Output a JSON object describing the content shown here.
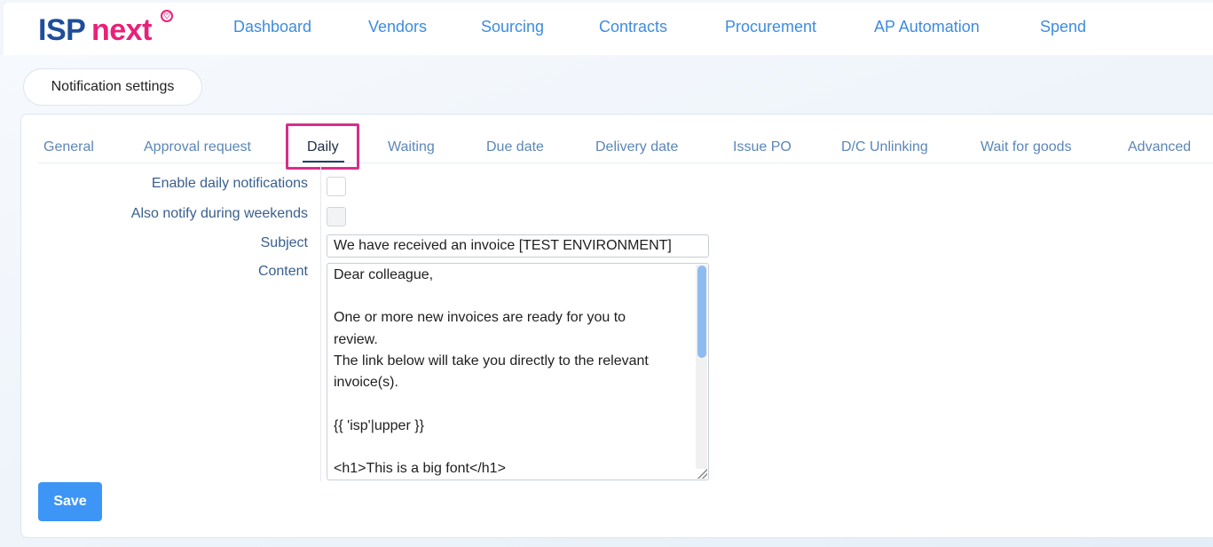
{
  "brand": {
    "logo_isp": "ISP",
    "logo_next": "next",
    "logo_mark": "♡",
    "accent": "#e8217a",
    "primary": "#1e4d9b"
  },
  "nav": {
    "items": [
      {
        "label": "Dashboard"
      },
      {
        "label": "Vendors"
      },
      {
        "label": "Sourcing"
      },
      {
        "label": "Contracts"
      },
      {
        "label": "Procurement"
      },
      {
        "label": "AP Automation"
      },
      {
        "label": "Spend"
      }
    ]
  },
  "page": {
    "title": "Notification settings"
  },
  "tabs": {
    "items": [
      {
        "label": "General"
      },
      {
        "label": "Approval request"
      },
      {
        "label": "Daily",
        "active": true
      },
      {
        "label": "Waiting"
      },
      {
        "label": "Due date"
      },
      {
        "label": "Delivery date"
      },
      {
        "label": "Issue PO"
      },
      {
        "label": "D/C Unlinking"
      },
      {
        "label": "Wait for goods"
      },
      {
        "label": "Advanced"
      }
    ]
  },
  "form": {
    "enable_daily_label": "Enable daily notifications",
    "enable_daily_checked": false,
    "weekends_label": "Also notify during weekends",
    "weekends_checked": false,
    "subject_label": "Subject",
    "subject_value": "We have received an invoice [TEST ENVIRONMENT]",
    "content_label": "Content",
    "content_lines": [
      "Dear colleague,",
      "",
      "One or more new invoices are ready for you to",
      "review.",
      "The link below will take you directly to the relevant",
      "invoice(s).",
      "",
      "{{ 'isp'|upper }}",
      "",
      "<h1>This is a big font</h1>"
    ],
    "save_label": "Save"
  },
  "colors": {
    "highlight": "#d62f8a",
    "save_button": "#3d96f5",
    "link": "#3d8ce0"
  }
}
